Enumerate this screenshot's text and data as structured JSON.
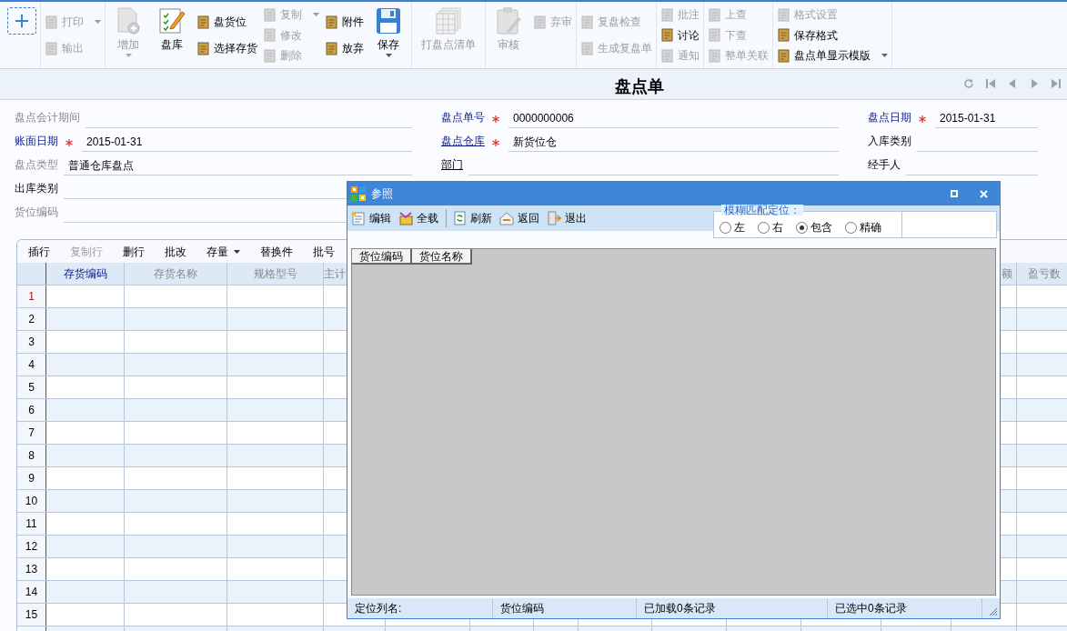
{
  "toolbar": {
    "groups": [
      {
        "columns": [
          {
            "kind": "add"
          }
        ]
      },
      {
        "columns": [
          {
            "kind": "stack",
            "buttons": [
              {
                "label": "打印",
                "disabled": true,
                "dropdown": true
              },
              {
                "label": "输出",
                "disabled": true,
                "dropdown": false
              }
            ]
          }
        ]
      },
      {
        "columns": [
          {
            "kind": "large",
            "label": "增加",
            "disabled": true,
            "dropdown": true
          },
          {
            "kind": "large",
            "label": "盘库",
            "disabled": false,
            "dropdown": false
          },
          {
            "kind": "stack",
            "buttons": [
              {
                "label": "盘货位",
                "disabled": false,
                "dropdown": false
              },
              {
                "label": "选择存货",
                "disabled": false,
                "dropdown": false
              }
            ]
          },
          {
            "kind": "stack",
            "buttons": [
              {
                "label": "复制",
                "disabled": true,
                "dropdown": true
              },
              {
                "label": "修改",
                "disabled": true,
                "dropdown": false
              },
              {
                "label": "删除",
                "disabled": true,
                "dropdown": false
              }
            ]
          },
          {
            "kind": "stack",
            "buttons": [
              {
                "label": "附件",
                "disabled": false,
                "dropdown": false
              },
              {
                "label": "放弃",
                "disabled": false,
                "dropdown": false
              }
            ]
          },
          {
            "kind": "large",
            "label": "保存",
            "disabled": false,
            "dropdown": true
          }
        ]
      },
      {
        "columns": [
          {
            "kind": "large",
            "label": "打盘点清单",
            "disabled": true,
            "dropdown": false
          }
        ]
      },
      {
        "columns": [
          {
            "kind": "large",
            "label": "审核",
            "disabled": true,
            "dropdown": false
          },
          {
            "kind": "stack",
            "buttons": [
              {
                "label": "弃审",
                "disabled": true,
                "dropdown": false
              }
            ]
          }
        ]
      },
      {
        "columns": [
          {
            "kind": "stack",
            "buttons": [
              {
                "label": "复盘检查",
                "disabled": true,
                "dropdown": false
              },
              {
                "label": "生成复盘单",
                "disabled": true,
                "dropdown": false
              }
            ]
          }
        ]
      },
      {
        "columns": [
          {
            "kind": "stack",
            "buttons": [
              {
                "label": "批注",
                "disabled": true,
                "dropdown": false
              },
              {
                "label": "讨论",
                "disabled": false,
                "dropdown": false
              },
              {
                "label": "通知",
                "disabled": true,
                "dropdown": false
              }
            ]
          }
        ]
      },
      {
        "columns": [
          {
            "kind": "stack",
            "buttons": [
              {
                "label": "上查",
                "disabled": true,
                "dropdown": false
              },
              {
                "label": "下查",
                "disabled": true,
                "dropdown": false
              },
              {
                "label": "整单关联",
                "disabled": true,
                "dropdown": false
              }
            ]
          }
        ]
      },
      {
        "columns": [
          {
            "kind": "stack",
            "buttons": [
              {
                "label": "格式设置",
                "disabled": true,
                "dropdown": false
              },
              {
                "label": "保存格式",
                "disabled": false,
                "dropdown": false
              },
              {
                "label": "盘点单显示模版",
                "disabled": false,
                "dropdown": true
              }
            ]
          }
        ]
      }
    ]
  },
  "title": "盘点单",
  "form": {
    "rows": [
      {
        "fields": [
          {
            "label": "盘点会计期间",
            "required": false,
            "link": false,
            "muted": true
          },
          {
            "label": "盘点单号",
            "value": "0000000006",
            "required": true,
            "link": false,
            "muted": false
          },
          {
            "label": "盘点日期",
            "value": "2015-01-31",
            "required": true,
            "link": false,
            "muted": false
          }
        ]
      },
      {
        "fields": [
          {
            "label": "账面日期",
            "value": "2015-01-31",
            "required": true,
            "link": false,
            "muted": false
          },
          {
            "label": "盘点仓库",
            "value": "新货位仓",
            "required": true,
            "link": true,
            "muted": false
          },
          {
            "label": "入库类别",
            "required": false,
            "link": false,
            "muted": false
          }
        ]
      },
      {
        "fields": [
          {
            "label": "盘点类型",
            "value": "普通仓库盘点",
            "required": false,
            "link": false,
            "muted": true
          },
          {
            "label": "部门",
            "required": false,
            "link": true,
            "muted": false
          },
          {
            "label": "经手人",
            "required": false,
            "link": false,
            "muted": false
          }
        ]
      },
      {
        "fields": [
          {
            "label": "出库类别",
            "required": false,
            "link": false,
            "muted": false
          }
        ]
      },
      {
        "fields": [
          {
            "label": "货位编码",
            "required": false,
            "link": false,
            "muted": true
          }
        ]
      }
    ]
  },
  "table": {
    "tools": [
      {
        "label": "插行",
        "disabled": false,
        "dropdown": false
      },
      {
        "label": "复制行",
        "disabled": true,
        "dropdown": false
      },
      {
        "label": "删行",
        "disabled": false,
        "dropdown": false
      },
      {
        "label": "批改",
        "disabled": false,
        "dropdown": false
      },
      {
        "label": "存量",
        "disabled": false,
        "dropdown": true
      },
      {
        "label": "替换件",
        "disabled": false,
        "dropdown": false
      },
      {
        "label": "批号",
        "disabled": false,
        "dropdown": false
      }
    ],
    "columns": [
      {
        "label": "存货编码",
        "selected": true
      },
      {
        "label": "存货名称",
        "selected": false
      },
      {
        "label": "规格型号",
        "selected": false
      },
      {
        "label": "主计",
        "selected": false
      }
    ],
    "right_columns": [
      {
        "label": "额",
        "selected": false
      },
      {
        "label": "盈亏数",
        "selected": false
      }
    ],
    "rows": [
      {
        "number": "1",
        "selected": true
      },
      {
        "number": "2",
        "selected": false
      },
      {
        "number": "3",
        "selected": false
      },
      {
        "number": "4",
        "selected": false
      },
      {
        "number": "5",
        "selected": false
      },
      {
        "number": "6",
        "selected": false
      },
      {
        "number": "7",
        "selected": false
      },
      {
        "number": "8",
        "selected": false
      },
      {
        "number": "9",
        "selected": false
      },
      {
        "number": "10",
        "selected": false
      },
      {
        "number": "11",
        "selected": false
      },
      {
        "number": "12",
        "selected": false
      },
      {
        "number": "13",
        "selected": false
      },
      {
        "number": "14",
        "selected": false
      },
      {
        "number": "15",
        "selected": false
      }
    ]
  },
  "dialog": {
    "title": "参照",
    "tools": [
      {
        "label": "编辑"
      },
      {
        "label": "全载"
      },
      {
        "label": "刷新"
      },
      {
        "label": "返回"
      },
      {
        "label": "退出"
      }
    ],
    "match": {
      "legend": "模糊匹配定位：",
      "options": [
        {
          "label": "左",
          "selected": false
        },
        {
          "label": "右",
          "selected": false
        },
        {
          "label": "包含",
          "selected": true
        },
        {
          "label": "精确",
          "selected": false
        }
      ]
    },
    "columns": [
      {
        "label": "货位编码"
      },
      {
        "label": "货位名称"
      }
    ],
    "status": [
      {
        "text": "定位列名:"
      },
      {
        "text": "货位编码"
      },
      {
        "text": "已加载0条记录"
      },
      {
        "text": "已选中0条记录"
      }
    ]
  }
}
